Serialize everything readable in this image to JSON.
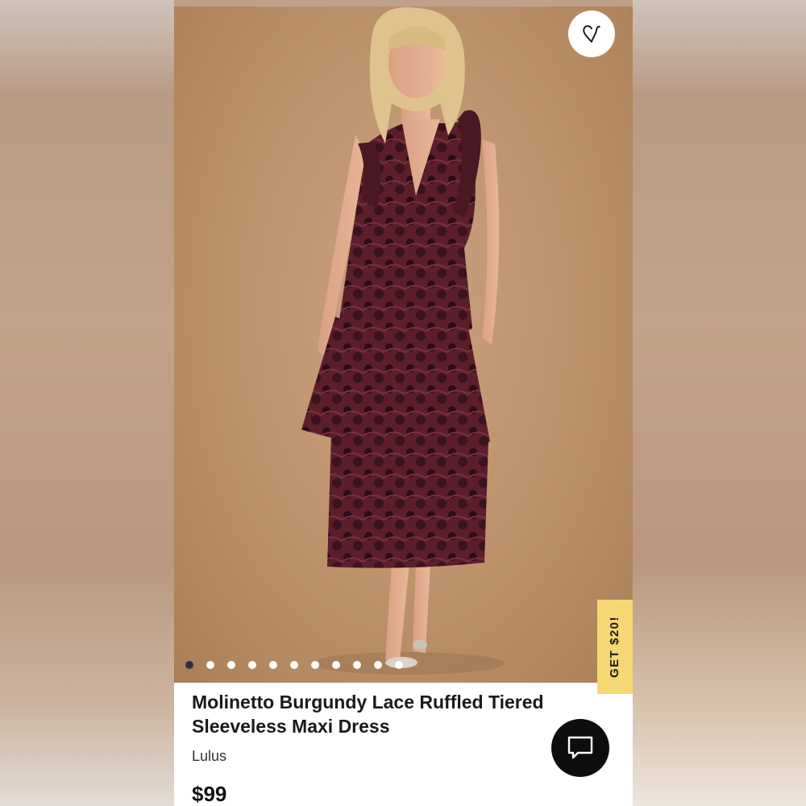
{
  "product": {
    "title": "Molinetto Burgundy Lace Ruffled Tiered Sleeveless Maxi Dress",
    "brand": "Lulus",
    "price": "$99"
  },
  "gallery": {
    "image_count": 11,
    "active_index": 0
  },
  "promo": {
    "label": "GET $20!"
  },
  "icons": {
    "favorite": "heart-icon",
    "chat": "chat-bubble-icon"
  },
  "colors": {
    "promo_tab": "#f7d774",
    "dress": "#5a1f2b",
    "active_dot": "#2b3140"
  }
}
